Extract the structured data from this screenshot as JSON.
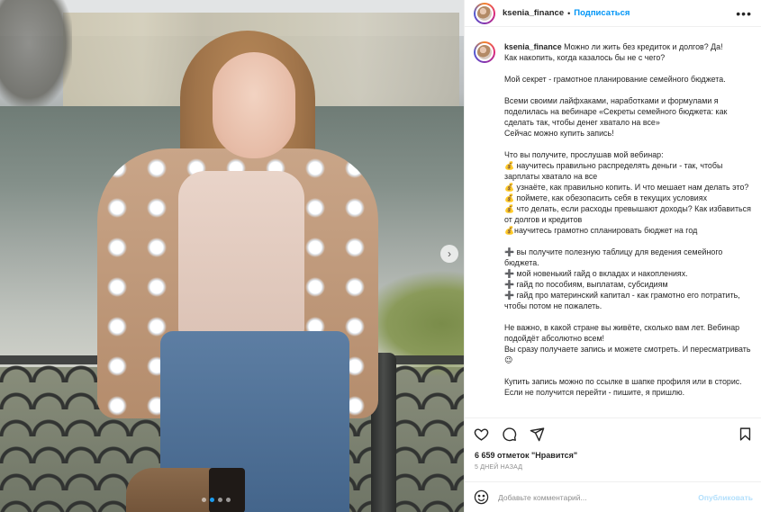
{
  "post": {
    "username": "ksenia_finance",
    "follow_label": "Подписаться",
    "more_label": "•••",
    "caption_username": "ksenia_finance",
    "caption_text": " Можно ли жить без кредиток и долгов? Да!\nКак накопить, когда казалось бы не с чего?\n\nМой секрет - грамотное планирование семейного бюджета.\n\nВсеми своими лайфхаками, наработками и формулами я поделилась на вебинаре «Секреты семейного бюджета: как сделать так, чтобы денег хватало на все»\nСейчас можно купить запись!\n\nЧто вы получите, прослушав мой вебинар:\n💰 научитесь правильно распределять деньги - так, чтобы зарплаты хватало на все\n💰 узнаёте, как правильно копить. И что мешает нам делать это?\n💰 поймете, как обезопасить себя в текущих условиях\n💰 что делать, если расходы превышают доходы? Как избавиться от долгов и кредитов\n💰научитесь грамотно спланировать бюджет на год\n\n➕ вы получите полезную таблицу для ведения семейного бюджета.\n➕ мой новенький гайд о вкладах и накоплениях.\n➕ гайд по пособиям, выплатам, субсидиям\n➕ гайд про материнский капитал - как грамотно его потратить, чтобы потом не пожалеть.\n\nНе важно, в какой стране вы живёте, сколько вам лет. Вебинар подойдёт абсолютно всем!\nВы сразу получаете запись и можете смотреть. И пересматривать 😉\n\nКупить запись можно по ссылке в шапке профиля или в сторис.\nЕсли не получится перейти - пишите, я пришлю.",
    "likes": "6 659 отметок \"Нравится\"",
    "date": "5 ДНЕЙ НАЗАД",
    "comment_placeholder": "Добавьте комментарий...",
    "publish_label": "Опубликовать"
  },
  "carousel": {
    "next_icon": "chevron-right-icon",
    "next_label": "›",
    "slide_count": 4,
    "active_slide": 1
  },
  "icons": {
    "like": "heart-icon",
    "comment": "comment-icon",
    "share": "share-icon",
    "save": "bookmark-icon",
    "emoji": "emoji-icon"
  },
  "colors": {
    "accent": "#0095f6",
    "publish_disabled": "#b2dffc",
    "carousel_active": "#1a9cf0"
  }
}
